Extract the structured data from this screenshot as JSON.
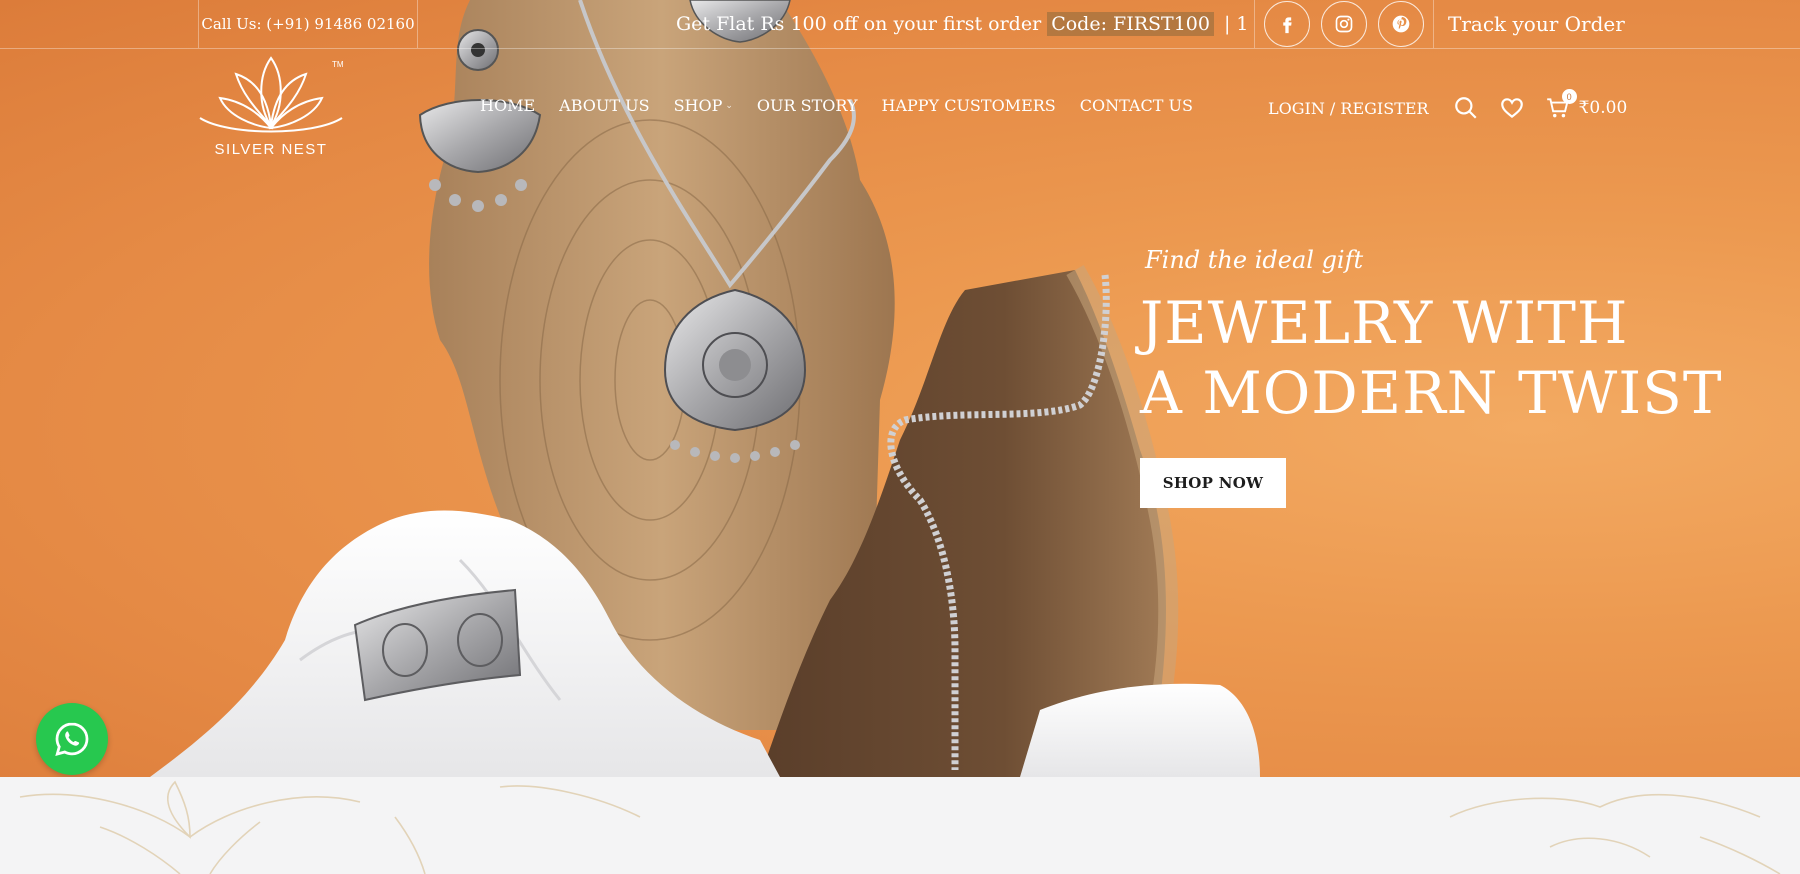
{
  "topbar": {
    "phone": "Call Us: (+91) 91486 02160",
    "promo_text": "Get Flat Rs 100 off on your first order",
    "promo_code": "Code: FIRST100",
    "promo_sep": "| 1",
    "track_order": "Track your Order",
    "socials": [
      {
        "icon": "facebook-icon"
      },
      {
        "icon": "instagram-icon"
      },
      {
        "icon": "pinterest-icon"
      }
    ]
  },
  "logo": {
    "brand": "SILVER NEST",
    "tm": "TM"
  },
  "nav": {
    "items": [
      {
        "label": "HOME"
      },
      {
        "label": "ABOUT US"
      },
      {
        "label": "SHOP"
      },
      {
        "label": "OUR STORY"
      },
      {
        "label": "HAPPY CUSTOMERS"
      },
      {
        "label": "CONTACT US"
      }
    ]
  },
  "header": {
    "login": "LOGIN / REGISTER",
    "cart_count": "0",
    "cart_total": "₹0.00"
  },
  "hero": {
    "eyebrow": "Find the ideal gift",
    "headline_line1": "JEWELRY WITH",
    "headline_line2": "A MODERN TWIST",
    "cta": "SHOP NOW"
  },
  "colors": {
    "hero_background": "#e8914a",
    "whatsapp": "#27c84f",
    "below_fold": "#f4f4f5"
  }
}
